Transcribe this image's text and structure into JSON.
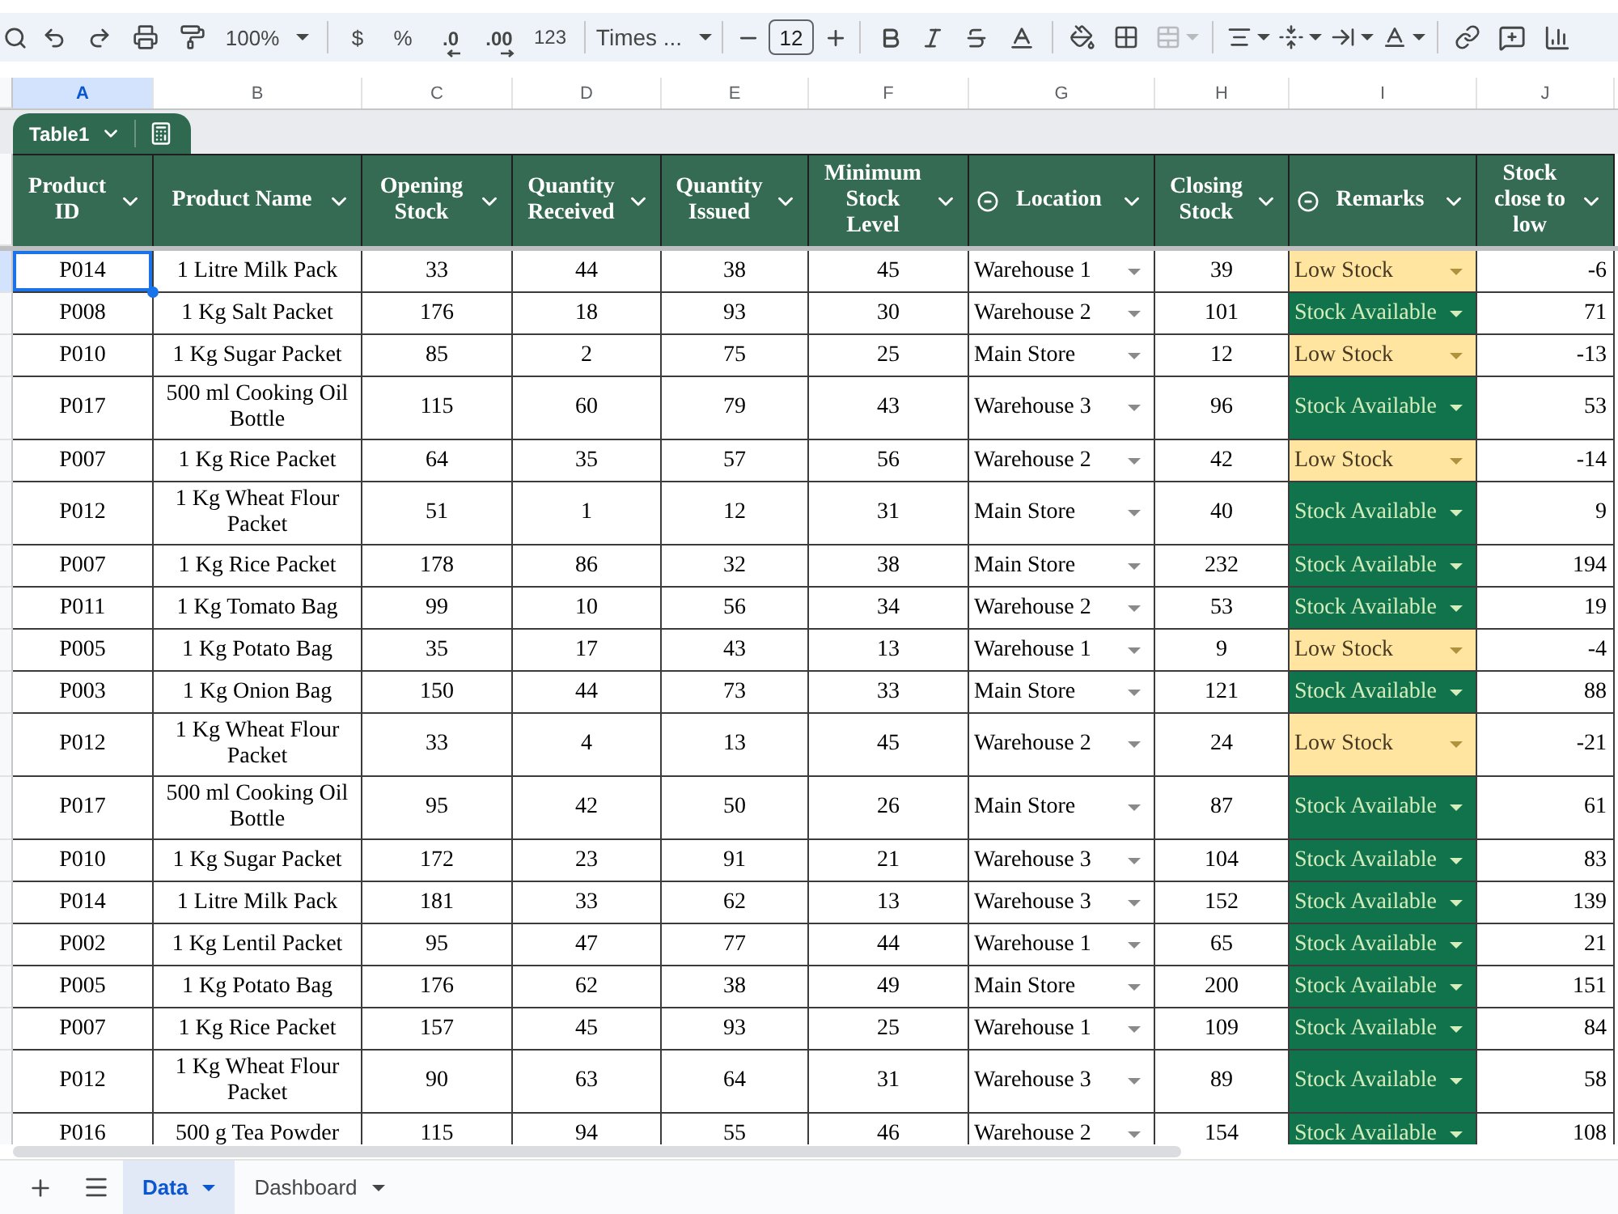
{
  "toolbar": {
    "zoom": "100%",
    "currency": "$",
    "percent": "%",
    "decrease_decimals": ".0",
    "increase_decimals": ".00",
    "number_format": "123",
    "font": "Times ...",
    "font_size": "12",
    "merge_disabled": true
  },
  "column_letters": [
    {
      "label": "A",
      "selected": true
    },
    {
      "label": "B",
      "selected": false
    },
    {
      "label": "C",
      "selected": false
    },
    {
      "label": "D",
      "selected": false
    },
    {
      "label": "E",
      "selected": false
    },
    {
      "label": "F",
      "selected": false
    },
    {
      "label": "G",
      "selected": false
    },
    {
      "label": "H",
      "selected": false
    },
    {
      "label": "I",
      "selected": false
    },
    {
      "label": "J",
      "selected": false
    }
  ],
  "table": {
    "name": "Table1",
    "columns": [
      {
        "label": "Product ID",
        "kind": "center"
      },
      {
        "label": "Product Name",
        "kind": "center"
      },
      {
        "label": "Opening Stock",
        "kind": "center"
      },
      {
        "label": "Quantity Received",
        "kind": "center"
      },
      {
        "label": "Quantity Issued",
        "kind": "center"
      },
      {
        "label": "Minimum Stock Level",
        "kind": "center"
      },
      {
        "label": "Location",
        "kind": "dropdown"
      },
      {
        "label": "Closing Stock",
        "kind": "center"
      },
      {
        "label": "Remarks",
        "kind": "status"
      },
      {
        "label": "Stock close to low",
        "kind": "right"
      }
    ],
    "rows": [
      {
        "selected": true,
        "kind": "low",
        "cells": [
          "P014",
          "1 Litre Milk Pack",
          "33",
          "44",
          "38",
          "45",
          "Warehouse 1",
          "39",
          "Low Stock",
          "-6"
        ]
      },
      {
        "selected": false,
        "kind": "available",
        "cells": [
          "P008",
          "1 Kg Salt Packet",
          "176",
          "18",
          "93",
          "30",
          "Warehouse 2",
          "101",
          "Stock Available",
          "71"
        ]
      },
      {
        "selected": false,
        "kind": "low",
        "cells": [
          "P010",
          "1 Kg Sugar Packet",
          "85",
          "2",
          "75",
          "25",
          "Main Store",
          "12",
          "Low Stock",
          "-13"
        ]
      },
      {
        "selected": false,
        "kind": "available",
        "cells": [
          "P017",
          "500 ml Cooking Oil Bottle",
          "115",
          "60",
          "79",
          "43",
          "Warehouse 3",
          "96",
          "Stock Available",
          "53"
        ]
      },
      {
        "selected": false,
        "kind": "low",
        "cells": [
          "P007",
          "1 Kg Rice Packet",
          "64",
          "35",
          "57",
          "56",
          "Warehouse 2",
          "42",
          "Low Stock",
          "-14"
        ]
      },
      {
        "selected": false,
        "kind": "available",
        "cells": [
          "P012",
          "1 Kg Wheat Flour Packet",
          "51",
          "1",
          "12",
          "31",
          "Main Store",
          "40",
          "Stock Available",
          "9"
        ]
      },
      {
        "selected": false,
        "kind": "available",
        "cells": [
          "P007",
          "1 Kg Rice Packet",
          "178",
          "86",
          "32",
          "38",
          "Main Store",
          "232",
          "Stock Available",
          "194"
        ]
      },
      {
        "selected": false,
        "kind": "available",
        "cells": [
          "P011",
          "1 Kg Tomato Bag",
          "99",
          "10",
          "56",
          "34",
          "Warehouse 2",
          "53",
          "Stock Available",
          "19"
        ]
      },
      {
        "selected": false,
        "kind": "low",
        "cells": [
          "P005",
          "1 Kg Potato Bag",
          "35",
          "17",
          "43",
          "13",
          "Warehouse 1",
          "9",
          "Low Stock",
          "-4"
        ]
      },
      {
        "selected": false,
        "kind": "available",
        "cells": [
          "P003",
          "1 Kg Onion Bag",
          "150",
          "44",
          "73",
          "33",
          "Main Store",
          "121",
          "Stock Available",
          "88"
        ]
      },
      {
        "selected": false,
        "kind": "low",
        "cells": [
          "P012",
          "1 Kg Wheat Flour Packet",
          "33",
          "4",
          "13",
          "45",
          "Warehouse 2",
          "24",
          "Low Stock",
          "-21"
        ]
      },
      {
        "selected": false,
        "kind": "available",
        "cells": [
          "P017",
          "500 ml Cooking Oil Bottle",
          "95",
          "42",
          "50",
          "26",
          "Main Store",
          "87",
          "Stock Available",
          "61"
        ]
      },
      {
        "selected": false,
        "kind": "available",
        "cells": [
          "P010",
          "1 Kg Sugar Packet",
          "172",
          "23",
          "91",
          "21",
          "Warehouse 3",
          "104",
          "Stock Available",
          "83"
        ]
      },
      {
        "selected": false,
        "kind": "available",
        "cells": [
          "P014",
          "1 Litre Milk Pack",
          "181",
          "33",
          "62",
          "13",
          "Warehouse 3",
          "152",
          "Stock Available",
          "139"
        ]
      },
      {
        "selected": false,
        "kind": "available",
        "cells": [
          "P002",
          "1 Kg Lentil Packet",
          "95",
          "47",
          "77",
          "44",
          "Warehouse 1",
          "65",
          "Stock Available",
          "21"
        ]
      },
      {
        "selected": false,
        "kind": "available",
        "cells": [
          "P005",
          "1 Kg Potato Bag",
          "176",
          "62",
          "38",
          "49",
          "Main Store",
          "200",
          "Stock Available",
          "151"
        ]
      },
      {
        "selected": false,
        "kind": "available",
        "cells": [
          "P007",
          "1 Kg Rice Packet",
          "157",
          "45",
          "93",
          "25",
          "Warehouse 1",
          "109",
          "Stock Available",
          "84"
        ]
      },
      {
        "selected": false,
        "kind": "available",
        "cells": [
          "P012",
          "1 Kg Wheat Flour Packet",
          "90",
          "63",
          "64",
          "31",
          "Warehouse 3",
          "89",
          "Stock Available",
          "58"
        ]
      },
      {
        "selected": false,
        "kind": "available",
        "cells": [
          "P016",
          "500 g Tea Powder",
          "115",
          "94",
          "55",
          "46",
          "Warehouse 2",
          "154",
          "Stock Available",
          "108"
        ]
      }
    ]
  },
  "sheet_tabs": [
    {
      "label": "Data",
      "selected": true
    },
    {
      "label": "Dashboard",
      "selected": false
    }
  ]
}
